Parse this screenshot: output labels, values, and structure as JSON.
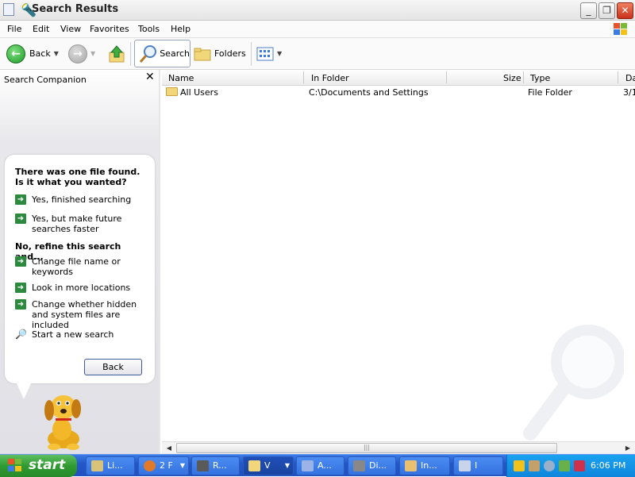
{
  "window": {
    "title": "Search Results",
    "controls": {
      "minimize": "_",
      "maximize": "❐",
      "close": "✕"
    }
  },
  "menubar": {
    "items": [
      "File",
      "Edit",
      "View",
      "Favorites",
      "Tools",
      "Help"
    ]
  },
  "toolbar": {
    "back_label": "Back",
    "search_label": "Search",
    "folders_label": "Folders"
  },
  "sidebar": {
    "title": "Search Companion",
    "close": "✕",
    "result_heading": "There was one file found.  Is it what you wanted?",
    "yes_options": [
      "Yes, finished searching",
      "Yes, but make future searches faster"
    ],
    "refine_heading": "No, refine this search and...",
    "refine_options": [
      "Change file name or keywords",
      "Look in more locations",
      "Change whether hidden and system files are included"
    ],
    "new_search": "Start a new search",
    "back_button": "Back"
  },
  "results": {
    "columns": [
      "Name",
      "In Folder",
      "Size",
      "Type",
      "Da"
    ],
    "rows": [
      {
        "name": "All Users",
        "in_folder": "C:\\Documents and Settings",
        "size": "",
        "type": "File Folder",
        "date": "3/1"
      }
    ]
  },
  "taskbar": {
    "start_label": "start",
    "tasks": [
      {
        "label": "Li...",
        "icon_color": "#d9c27a"
      },
      {
        "label": "2 F",
        "icon_color": "#e07a2a"
      },
      {
        "label": "R...",
        "icon_color": "#5a5a5a"
      },
      {
        "label": "V",
        "icon_color": "#f1d77a"
      },
      {
        "label": "A...",
        "icon_color": "#9ab4e8"
      },
      {
        "label": "Di...",
        "icon_color": "#888888"
      },
      {
        "label": "In...",
        "icon_color": "#e8c070"
      },
      {
        "label": "I",
        "icon_color": "#c8d4ea"
      }
    ],
    "clock": "6:06 PM"
  },
  "colors": {
    "taskbar_blue": "#2457c8",
    "start_green": "#2f9a32",
    "tray_blue": "#0e86dc",
    "arrow_green": "#2b8a3e",
    "close_red": "#c8321a"
  }
}
